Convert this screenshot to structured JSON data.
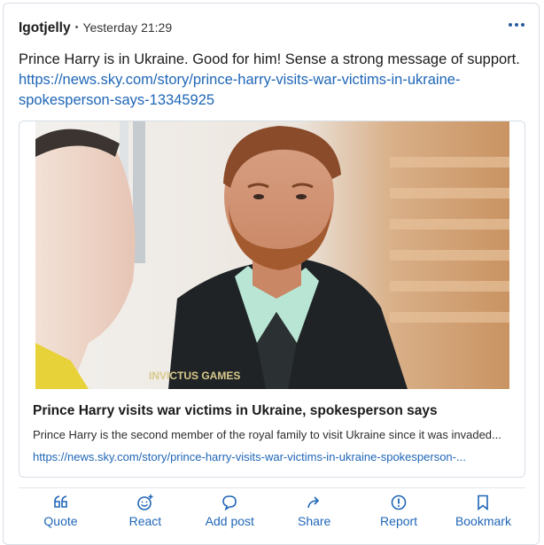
{
  "post": {
    "author": "Igotjelly",
    "separator": "•",
    "time": "Yesterday 21:29",
    "text": "Prince Harry is in Ukraine. Good for him! Sense a strong message of support.",
    "link": "https://news.sky.com/story/prince-harry-visits-war-victims-in-ukraine-spokesperson-says-13345925"
  },
  "link_preview": {
    "image_description": "photo-prince-harry",
    "title": "Prince Harry visits war victims in Ukraine, spokesperson says",
    "description": "Prince Harry is the second member of the royal family to visit Ukraine since it was invaded...",
    "url": "https://news.sky.com/story/prince-harry-visits-war-victims-in-ukraine-spokesperson-...",
    "jacket_text": "INVICTUS GAMES"
  },
  "actions": [
    {
      "label": "Quote",
      "icon": "quote-icon"
    },
    {
      "label": "React",
      "icon": "react-icon"
    },
    {
      "label": "Add post",
      "icon": "comment-icon"
    },
    {
      "label": "Share",
      "icon": "share-icon"
    },
    {
      "label": "Report",
      "icon": "report-icon"
    },
    {
      "label": "Bookmark",
      "icon": "bookmark-icon"
    }
  ],
  "colors": {
    "link": "#1f66b7",
    "text": "#1c1c1c",
    "border": "#d7dde5"
  }
}
